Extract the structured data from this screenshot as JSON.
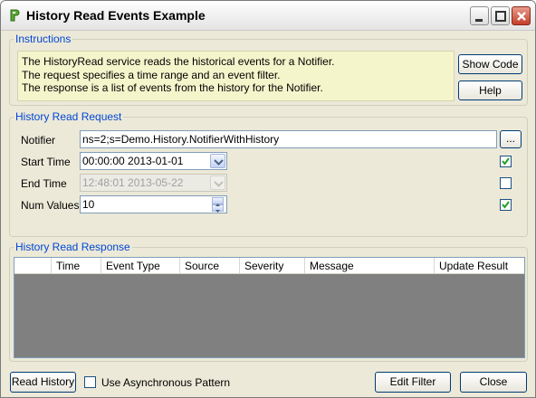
{
  "window": {
    "title": "History Read Events Example"
  },
  "instructions": {
    "group_label": "Instructions",
    "lines": [
      "The HistoryRead service reads the historical events for a Notifier.",
      "The request specifies a time range and an event filter.",
      "The response is a list of events from the history for the Notifier."
    ],
    "show_code_label": "Show Code",
    "help_label": "Help"
  },
  "request": {
    "group_label": "History Read Request",
    "notifier_label": "Notifier",
    "notifier_value": "ns=2;s=Demo.History.NotifierWithHistory",
    "browse_label": "...",
    "start_time_label": "Start Time",
    "start_time_value": "00:00:00 2013-01-01",
    "start_time_checked": true,
    "end_time_label": "End Time",
    "end_time_value": "12:48:01 2013-05-22",
    "end_time_checked": false,
    "num_values_label": "Num Values",
    "num_values_value": "10",
    "num_values_checked": true
  },
  "response": {
    "group_label": "History Read Response",
    "columns": [
      "",
      "Time",
      "Event Type",
      "Source",
      "Severity",
      "Message",
      "Update Result"
    ]
  },
  "footer": {
    "read_history_label": "Read History",
    "async_label": "Use Asynchronous Pattern",
    "async_checked": false,
    "edit_filter_label": "Edit Filter",
    "close_label": "Close"
  },
  "colors": {
    "accent": "#0046d5",
    "panel": "#ece9d8",
    "instructions_bg": "#f5f5cc",
    "grid_bg": "#808080",
    "close_button": "#c4402b"
  }
}
